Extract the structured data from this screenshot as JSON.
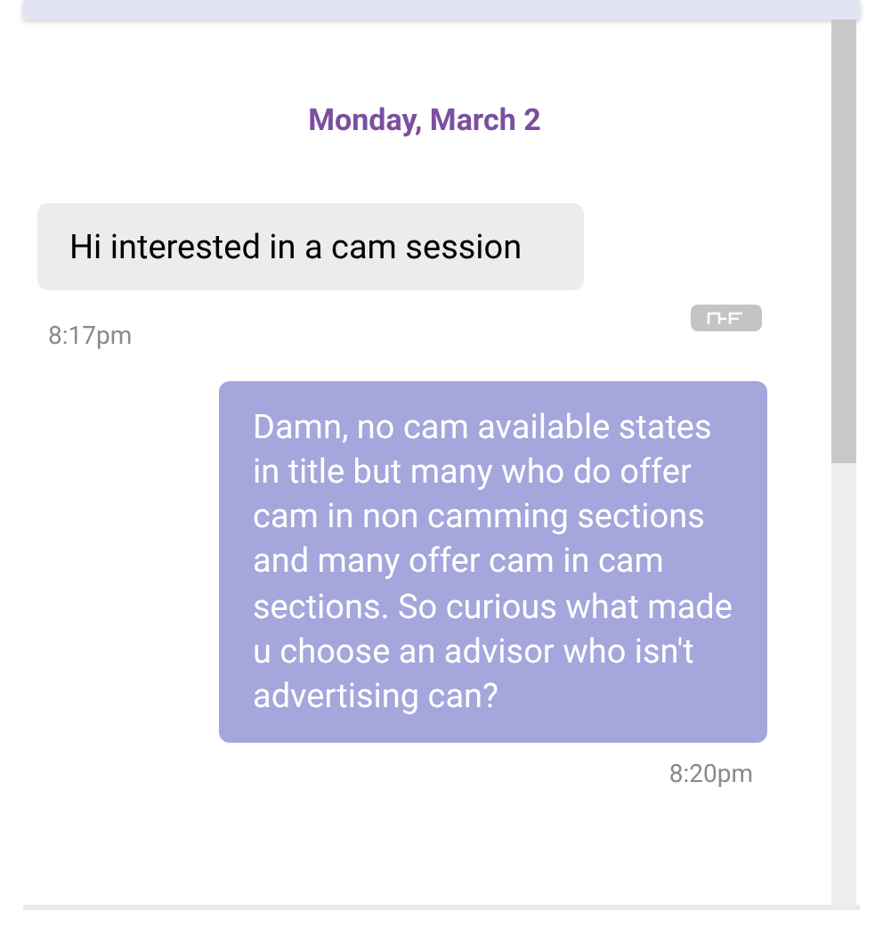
{
  "date_header": "Monday, March 2",
  "messages": [
    {
      "kind": "incoming",
      "text": "Hi interested in a cam session",
      "time": "8:17pm"
    },
    {
      "kind": "outgoing",
      "text": "Damn, no cam available states in title but many who do offer cam in non camming sections and many offer cam in cam sections. So curious what made u choose an advisor who isn't advertising can?",
      "time": "8:20pm"
    }
  ]
}
